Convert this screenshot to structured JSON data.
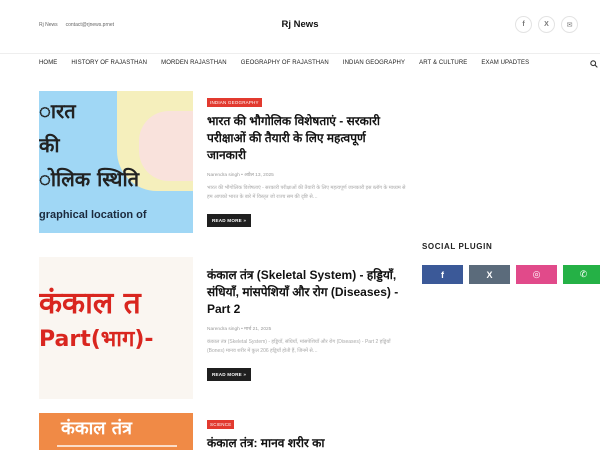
{
  "top": {
    "links": [
      "Rj News",
      "contact@rjnews.prnet"
    ],
    "brand": "Rj News",
    "social": [
      {
        "icon": "facebook-icon",
        "glyph": "f"
      },
      {
        "icon": "x-icon",
        "glyph": "X"
      },
      {
        "icon": "mail-icon",
        "glyph": "✉"
      }
    ]
  },
  "nav": {
    "items": [
      "HOME",
      "HISTORY OF RAJASTHAN",
      "MORDEN RAJASTHAN",
      "GEOGRAPHY OF RAJASTHAN",
      "INDIAN GEOGRAPHY",
      "ART & CULTURE",
      "EXAM UPADTES"
    ],
    "search_icon": "search-icon"
  },
  "posts": [
    {
      "category": "INDIAN GEOGRAPHY",
      "title": "भारत की भौगोलिक विशेषताएं - सरकारी परीक्षाओं की तैयारी के लिए महत्वपूर्ण जानकारी",
      "author": "Narendra singh",
      "date": "अप्रैल 13, 2025",
      "excerpt": "भारत की भौगोलिक विशेषताएं - सरकारी परीक्षाओं की तैयारी के लिए महत्वपूर्ण जानकारी इस ब्लॉग के माध्यम से हम आपको भारत के बारे में विस्तृत जो राज्य सम की दृष्टि से…",
      "readmore": "READ MORE »",
      "thumb_lines": [
        "ारत",
        "की",
        "ोलिक स्थिति"
      ],
      "thumb_caption": "graphical location of"
    },
    {
      "category": "",
      "title": "कंकाल तंत्र (Skeletal System) - हड्डियाँ, संधियाँ, मांसपेशियाँ और रोग (Diseases) - Part 2",
      "author": "Narendra singh",
      "date": "मार्च 21, 2025",
      "excerpt": "कंकाल तंत्र (Skeletal System) - हड्डियाँ, संधियाँ, मांसपेशियाँ और रोग (Diseases) - Part 2 हड्डियाँ (Bones) मानव शरीर में कुल 206 हड्डियाँ होती हैं, जिनमें से…",
      "readmore": "READ MORE »",
      "thumb_lines": [
        "कंकाल त",
        "Part(भाग)-"
      ]
    },
    {
      "category": "SCIENCE",
      "title": "कंकाल तंत्र: मानव शरीर का",
      "thumb_lines": [
        "कंकाल तंत्र"
      ]
    }
  ],
  "sidebar": {
    "title": "SOCIAL PLUGIN",
    "buttons": [
      {
        "icon": "facebook-icon",
        "glyph": "f",
        "color": "#3b5998"
      },
      {
        "icon": "x-icon",
        "glyph": "X",
        "color": "#5b6b7b"
      },
      {
        "icon": "instagram-icon",
        "glyph": "◎",
        "color": "#e14a8a"
      },
      {
        "icon": "whatsapp-icon",
        "glyph": "✆",
        "color": "#25b146"
      }
    ]
  }
}
